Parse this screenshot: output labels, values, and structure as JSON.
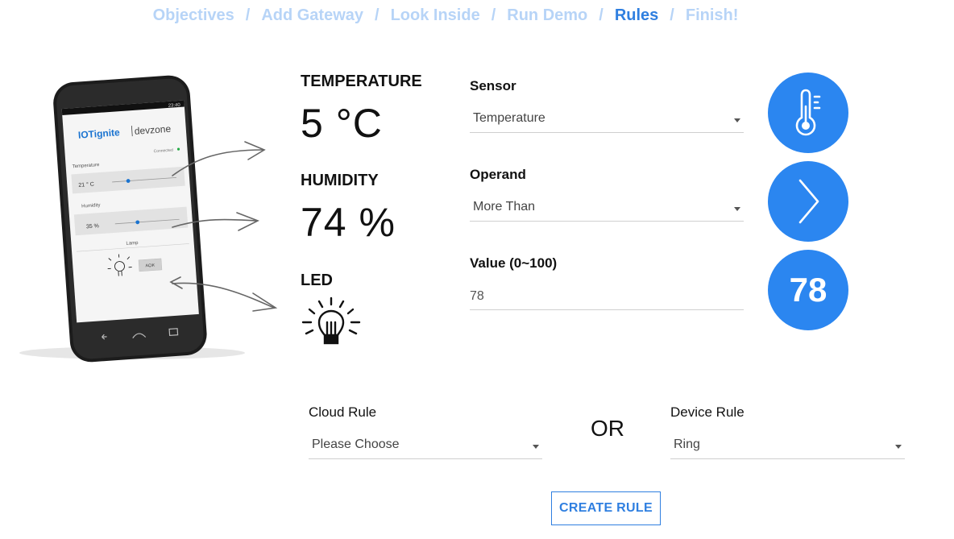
{
  "breadcrumb": {
    "items": [
      {
        "label": "Objectives"
      },
      {
        "label": "Add Gateway"
      },
      {
        "label": "Look Inside"
      },
      {
        "label": "Run Demo"
      },
      {
        "label": "Rules"
      },
      {
        "label": "Finish!"
      }
    ],
    "separator": "/",
    "active_index": 4
  },
  "phone": {
    "status_time": "23:40",
    "brand_left": "IOTignite",
    "brand_right": "devzone",
    "connection_status": "Connected",
    "temperature_label": "Temperature",
    "temperature_value": "21 ° C",
    "temperature_level_fraction": 0.25,
    "humidity_label": "Humidity",
    "humidity_value": "35 %",
    "humidity_level_fraction": 0.35,
    "lamp_label": "Lamp",
    "lamp_button_label": "AÇIK"
  },
  "readings": {
    "temperature_title": "TEMPERATURE",
    "temperature_value": "5 °C",
    "humidity_title": "HUMIDITY",
    "humidity_value": "74 %",
    "led_title": "LED"
  },
  "form": {
    "sensor_label": "Sensor",
    "sensor_value": "Temperature",
    "operand_label": "Operand",
    "operand_value": "More Than",
    "value_label": "Value (0~100)",
    "value_input": "78"
  },
  "indicators": {
    "value_display": "78"
  },
  "rules": {
    "cloud_label": "Cloud Rule",
    "cloud_value": "Please Choose",
    "or_text": "OR",
    "device_label": "Device Rule",
    "device_value": "Ring",
    "create_button": "CREATE RULE"
  },
  "colors": {
    "accent": "#2b86f0",
    "crumb_inactive": "#b7d4f7",
    "crumb_active": "#2f7fe0"
  }
}
